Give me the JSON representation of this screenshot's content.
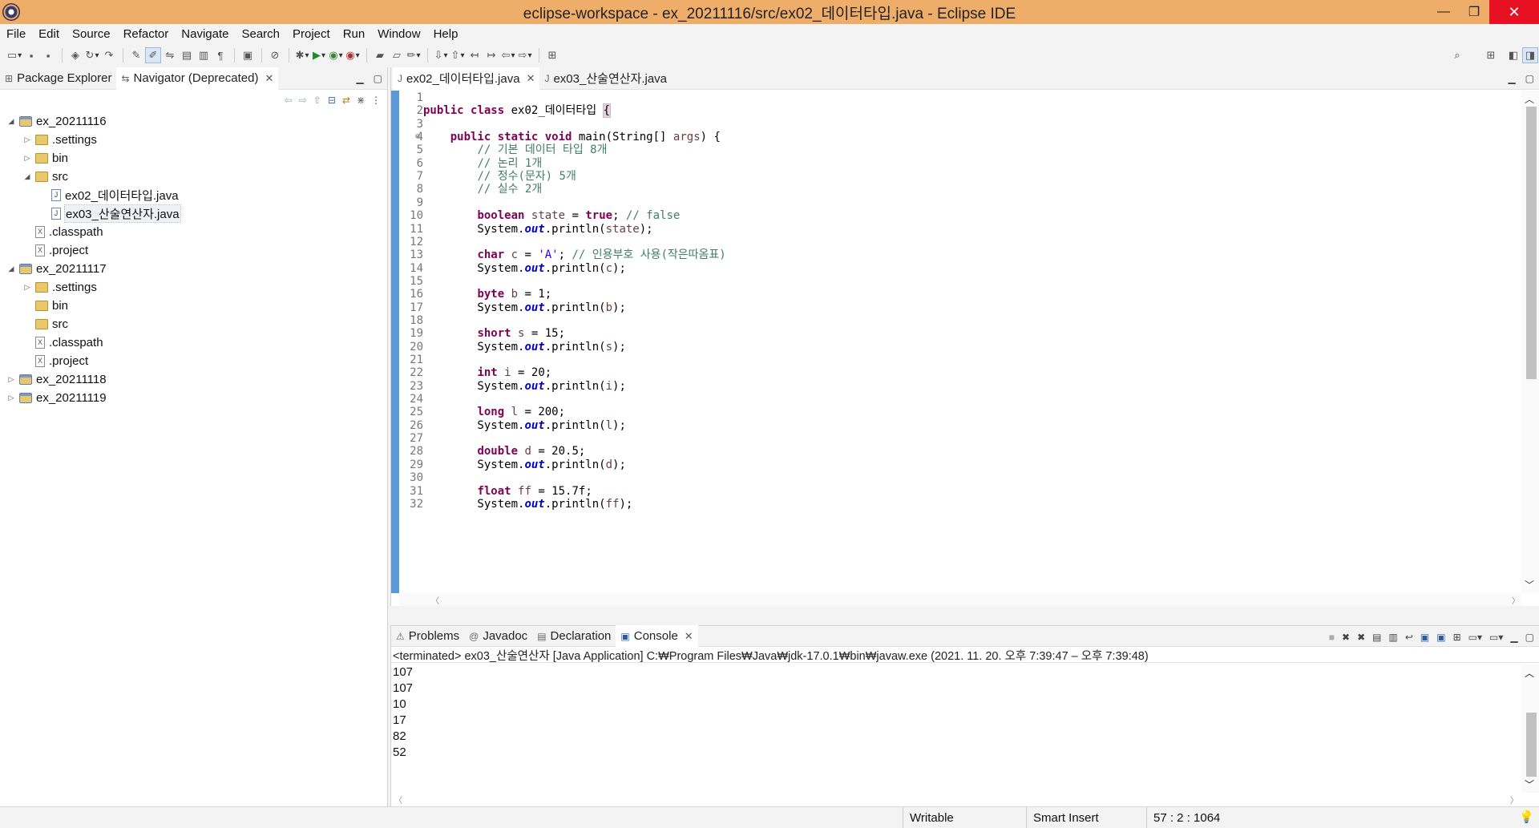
{
  "window": {
    "title": "eclipse-workspace - ex_20211116/src/ex02_데이터타입.java - Eclipse IDE",
    "minimize": "—",
    "maximize": "❐",
    "close": "✕"
  },
  "menu": [
    "File",
    "Edit",
    "Source",
    "Refactor",
    "Navigate",
    "Search",
    "Project",
    "Run",
    "Window",
    "Help"
  ],
  "left_view": {
    "tabs": [
      {
        "label": "Package Explorer",
        "icon": "package-icon"
      },
      {
        "label": "Navigator (Deprecated)",
        "icon": "navigator-icon"
      }
    ],
    "tree": [
      {
        "label": "ex_20211116",
        "level": 0,
        "type": "project",
        "expanded": true
      },
      {
        "label": ".settings",
        "level": 1,
        "type": "folder",
        "expanded": false
      },
      {
        "label": "bin",
        "level": 1,
        "type": "folder",
        "expanded": false
      },
      {
        "label": "src",
        "level": 1,
        "type": "folder",
        "expanded": true
      },
      {
        "label": "ex02_데이터타입.java",
        "level": 2,
        "type": "java"
      },
      {
        "label": "ex03_산술연산자.java",
        "level": 2,
        "type": "java",
        "selected": true
      },
      {
        "label": ".classpath",
        "level": 1,
        "type": "xml"
      },
      {
        "label": ".project",
        "level": 1,
        "type": "xml"
      },
      {
        "label": "ex_20211117",
        "level": 0,
        "type": "project",
        "expanded": true
      },
      {
        "label": ".settings",
        "level": 1,
        "type": "folder",
        "expanded": false
      },
      {
        "label": "bin",
        "level": 1,
        "type": "folder"
      },
      {
        "label": "src",
        "level": 1,
        "type": "folder"
      },
      {
        "label": ".classpath",
        "level": 1,
        "type": "xml"
      },
      {
        "label": ".project",
        "level": 1,
        "type": "xml"
      },
      {
        "label": "ex_20211118",
        "level": 0,
        "type": "project",
        "expanded": false
      },
      {
        "label": "ex_20211119",
        "level": 0,
        "type": "project",
        "expanded": false
      }
    ]
  },
  "editor": {
    "tabs": [
      {
        "label": "ex02_데이터타입.java",
        "active": true
      },
      {
        "label": "ex03_산술연산자.java",
        "active": false
      }
    ],
    "lines": [
      {
        "n": "1",
        "html": ""
      },
      {
        "n": "2",
        "html": "<span class='kw'>public</span> <span class='kw'>class</span> ex02_데이터타입 <span class='bracebox'>{</span>"
      },
      {
        "n": "3",
        "html": ""
      },
      {
        "n": "4",
        "fold": true,
        "html": "    <span class='kw'>public</span> <span class='kw'>static</span> <span class='kw'>void</span> main(String[] <span class='var'>args</span>) {"
      },
      {
        "n": "5",
        "html": "        <span class='cm'>// 기본 데이터 타입 8개</span>"
      },
      {
        "n": "6",
        "html": "        <span class='cm'>// 논리 1개</span>"
      },
      {
        "n": "7",
        "html": "        <span class='cm'>// 정수(문자) 5개</span>"
      },
      {
        "n": "8",
        "html": "        <span class='cm'>// 실수 2개</span>"
      },
      {
        "n": "9",
        "html": ""
      },
      {
        "n": "10",
        "html": "        <span class='kw'>boolean</span> <span class='var'>state</span> = <span class='kw'>true</span>; <span class='cm'>// false</span>"
      },
      {
        "n": "11",
        "html": "        System.<span class='fld'>out</span>.println(<span class='var'>state</span>);"
      },
      {
        "n": "12",
        "html": ""
      },
      {
        "n": "13",
        "html": "        <span class='kw'>char</span> <span class='var'>c</span> = <span class='str'>'A'</span>; <span class='cm'>// 인용부호 사용(작은따옴표)</span>"
      },
      {
        "n": "14",
        "html": "        System.<span class='fld'>out</span>.println(<span class='var'>c</span>);"
      },
      {
        "n": "15",
        "html": ""
      },
      {
        "n": "16",
        "html": "        <span class='kw'>byte</span> <span class='var'>b</span> = 1;"
      },
      {
        "n": "17",
        "html": "        System.<span class='fld'>out</span>.println(<span class='var'>b</span>);"
      },
      {
        "n": "18",
        "html": ""
      },
      {
        "n": "19",
        "html": "        <span class='kw'>short</span> <span class='var'>s</span> = 15;"
      },
      {
        "n": "20",
        "html": "        System.<span class='fld'>out</span>.println(<span class='var'>s</span>);"
      },
      {
        "n": "21",
        "html": ""
      },
      {
        "n": "22",
        "html": "        <span class='kw'>int</span> <span class='var'>i</span> = 20;"
      },
      {
        "n": "23",
        "html": "        System.<span class='fld'>out</span>.println(<span class='var'>i</span>);"
      },
      {
        "n": "24",
        "html": ""
      },
      {
        "n": "25",
        "html": "        <span class='kw'>long</span> <span class='var'>l</span> = 200;"
      },
      {
        "n": "26",
        "html": "        System.<span class='fld'>out</span>.println(<span class='var'>l</span>);"
      },
      {
        "n": "27",
        "html": ""
      },
      {
        "n": "28",
        "html": "        <span class='kw'>double</span> <span class='var'>d</span> = 20.5;"
      },
      {
        "n": "29",
        "html": "        System.<span class='fld'>out</span>.println(<span class='var'>d</span>);"
      },
      {
        "n": "30",
        "html": ""
      },
      {
        "n": "31",
        "html": "        <span class='kw'>float</span> <span class='var'>ff</span> = 15.7f;"
      },
      {
        "n": "32",
        "html": "        System.<span class='fld'>out</span>.println(<span class='var'>ff</span>);"
      }
    ]
  },
  "bottom_view": {
    "tabs": [
      {
        "label": "Problems",
        "icon": "problems-icon"
      },
      {
        "label": "Javadoc",
        "icon": "javadoc-icon"
      },
      {
        "label": "Declaration",
        "icon": "declaration-icon"
      },
      {
        "label": "Console",
        "icon": "console-icon",
        "active": true
      }
    ],
    "console_header": "<terminated> ex03_산술연산자 [Java Application] C:₩Program Files₩Java₩jdk-17.0.1₩bin₩javaw.exe  (2021. 11. 20. 오후 7:39:47 – 오후 7:39:48)",
    "console_lines": [
      "107",
      "107",
      "10",
      "17",
      "82",
      "52"
    ]
  },
  "status": {
    "writable": "Writable",
    "insert_mode": "Smart Insert",
    "position": "57 : 2 : 1064"
  }
}
